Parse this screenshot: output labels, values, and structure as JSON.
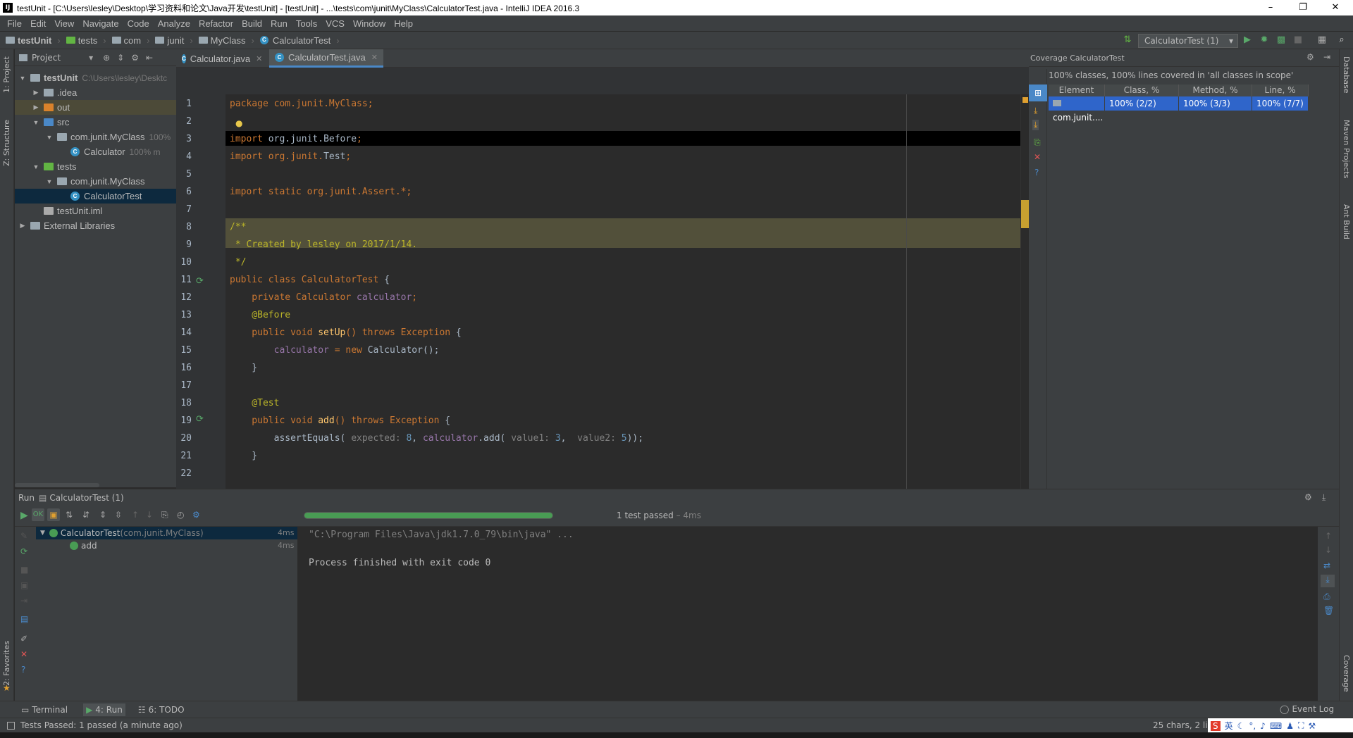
{
  "window": {
    "title": "testUnit - [C:\\Users\\lesley\\Desktop\\学习资料和论文\\Java开发\\testUnit] - [testUnit] - ...\\tests\\com\\junit\\MyClass\\CalculatorTest.java - IntelliJ IDEA 2016.3"
  },
  "menu": [
    "File",
    "Edit",
    "View",
    "Navigate",
    "Code",
    "Analyze",
    "Refactor",
    "Build",
    "Run",
    "Tools",
    "VCS",
    "Window",
    "Help"
  ],
  "breadcrumbs": [
    "testUnit",
    "tests",
    "com",
    "junit",
    "MyClass",
    "CalculatorTest"
  ],
  "run_config": "CalculatorTest (1)",
  "left_tabs": {
    "project": "1: Project",
    "structure": "Z: Structure",
    "favorites": "2: Favorites"
  },
  "right_tabs": {
    "database": "Database",
    "maven": "Maven Projects",
    "ant": "Ant Build",
    "coverage": "Coverage"
  },
  "project_panel": {
    "title": "Project",
    "tree": [
      {
        "label": "testUnit",
        "extra": "C:\\Users\\lesley\\Desktc",
        "indent": 0,
        "icon": "folder",
        "open": true
      },
      {
        "label": ".idea",
        "extra": "",
        "indent": 1,
        "icon": "folder",
        "open": false
      },
      {
        "label": "out",
        "extra": "",
        "indent": 1,
        "icon": "folder-orange",
        "open": false
      },
      {
        "label": "src",
        "extra": "",
        "indent": 1,
        "icon": "folder-blue",
        "open": true
      },
      {
        "label": "com.junit.MyClass",
        "extra": "100%",
        "indent": 2,
        "icon": "package",
        "open": true
      },
      {
        "label": "Calculator",
        "extra": "100% m",
        "indent": 3,
        "icon": "class"
      },
      {
        "label": "tests",
        "extra": "",
        "indent": 1,
        "icon": "folder-green",
        "open": true
      },
      {
        "label": "com.junit.MyClass",
        "extra": "",
        "indent": 2,
        "icon": "package",
        "open": true
      },
      {
        "label": "CalculatorTest",
        "extra": "",
        "indent": 3,
        "icon": "class",
        "selected": true
      },
      {
        "label": "testUnit.iml",
        "extra": "",
        "indent": 1,
        "icon": "file"
      },
      {
        "label": "External Libraries",
        "extra": "",
        "indent": 0,
        "icon": "library",
        "open": false
      }
    ]
  },
  "editor_tabs": [
    {
      "label": "Calculator.java",
      "active": false
    },
    {
      "label": "CalculatorTest.java",
      "active": true
    }
  ],
  "line_numbers": [
    "1",
    "2",
    "3",
    "4",
    "5",
    "6",
    "7",
    "8",
    "9",
    "10",
    "11",
    "12",
    "13",
    "14",
    "15",
    "16",
    "17",
    "18",
    "19",
    "20",
    "21",
    "22"
  ],
  "code": {
    "l1_kw": "package ",
    "l1_pk": "com.junit.MyClass",
    "l1_end": ";",
    "l3_kw": "import ",
    "l3_pk": "org.junit.Before",
    "l3_end": ";",
    "l4_kw": "import ",
    "l4_pk": "org.junit.",
    "l4_ty": "Test",
    "l4_end": ";",
    "l6_kw": "import static ",
    "l6_pk": "org.junit.",
    "l6_ty": "Assert",
    "l6_end": ".*;",
    "l8": "/**",
    "l9": " * Created by lesley on 2017/1/14.",
    "l10": " */",
    "l11_kw": "public class ",
    "l11_ty": "CalculatorTest",
    "l11_end": " {",
    "l12_kw": "    private ",
    "l12_ty": "Calculator",
    "l12_fld": " calculator",
    "l12_end": ";",
    "l13": "    @Before",
    "l14_kw": "    public void ",
    "l14_fn": "setUp",
    "l14_mid": "() throws ",
    "l14_ty": "Exception",
    "l14_end": " {",
    "l15_fld": "        calculator",
    "l15_mid": " = new ",
    "l15_ty": "Calculator",
    "l15_end": "();",
    "l16": "    }",
    "l18": "    @Test",
    "l19_kw": "    public void ",
    "l19_fn": "add",
    "l19_mid": "() throws ",
    "l19_ty": "Exception",
    "l19_end": " {",
    "l20_a": "        assertEquals(",
    "l20_h1": " expected: ",
    "l20_n1": "8",
    "l20_b": ", ",
    "l20_fld": "calculator",
    "l20_c": ".add(",
    "l20_h2": " value1: ",
    "l20_n2": "3",
    "l20_d": ",  ",
    "l20_h3": "value2: ",
    "l20_n3": "5",
    "l20_e": "));",
    "l21": "    }",
    "l23": "}"
  },
  "coverage_panel": {
    "title": "Coverage CalculatorTest",
    "summary": "100% classes, 100% lines covered in 'all classes in scope'",
    "columns": [
      "Element",
      "Class, %",
      "Method, %",
      "Line, %"
    ],
    "row": [
      "com.junit....",
      "100% (2/2)",
      "100% (3/3)",
      "100% (7/7)"
    ]
  },
  "run_panel": {
    "title": "Run",
    "config": "CalculatorTest (1)",
    "progress": 1.0,
    "status": "1 test passed",
    "duration": " – 4ms",
    "tree": [
      {
        "label": "CalculatorTest",
        "extra": " (com.junit.MyClass)",
        "time": "4ms"
      },
      {
        "label": "add",
        "extra": "",
        "time": "4ms"
      }
    ],
    "console": [
      "\"C:\\Program Files\\Java\\jdk1.7.0_79\\bin\\java\" ...",
      "",
      "Process finished with exit code 0"
    ]
  },
  "bottom_tabs": [
    {
      "label": "Terminal"
    },
    {
      "label": "4: Run"
    },
    {
      "label": "6: TODO"
    }
  ],
  "event_log": "Event Log",
  "status": {
    "message": "Tests Passed: 1 passed (a minute ago)",
    "position": "25 chars, 2 lin"
  },
  "colors": {
    "accent": "#4a88c7",
    "selection": "#2f65ca",
    "progress": "#499c54"
  }
}
